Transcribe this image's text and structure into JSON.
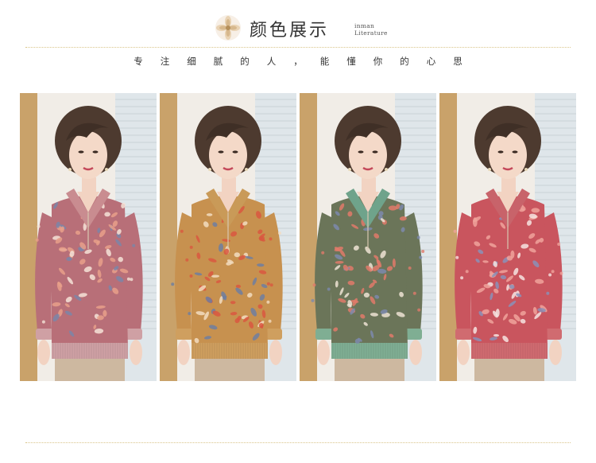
{
  "header": {
    "title": "颜色展示",
    "subtitle_line1": "inman",
    "subtitle_line2": "Literature",
    "logo_icon": "flower-icon"
  },
  "tagline": "专注细腻的人，能懂你的心思",
  "colors": {
    "accent_rule": "#d9c58a"
  },
  "variants": [
    {
      "name": "pink-rose",
      "body": "#b86f78",
      "collar": "#c98c90",
      "hem": "#cfa0a4",
      "leaf1": "#e8a089",
      "leaf2": "#f4e3d7",
      "leaf3": "#7a86a8"
    },
    {
      "name": "camel",
      "body": "#c7914f",
      "collar": "#c99a58",
      "hem": "#cf9f5f",
      "leaf1": "#d9573f",
      "leaf2": "#f2dcc0",
      "leaf3": "#6e7ea0"
    },
    {
      "name": "green",
      "body": "#6b7559",
      "collar": "#6fa38b",
      "hem": "#7fae93",
      "leaf1": "#e07a6a",
      "leaf2": "#ede3d3",
      "leaf3": "#7c89ad"
    },
    {
      "name": "coral-red",
      "body": "#c9555e",
      "collar": "#c8636a",
      "hem": "#d06b70",
      "leaf1": "#f0a39b",
      "leaf2": "#f6e4e0",
      "leaf3": "#8a92b8"
    }
  ]
}
